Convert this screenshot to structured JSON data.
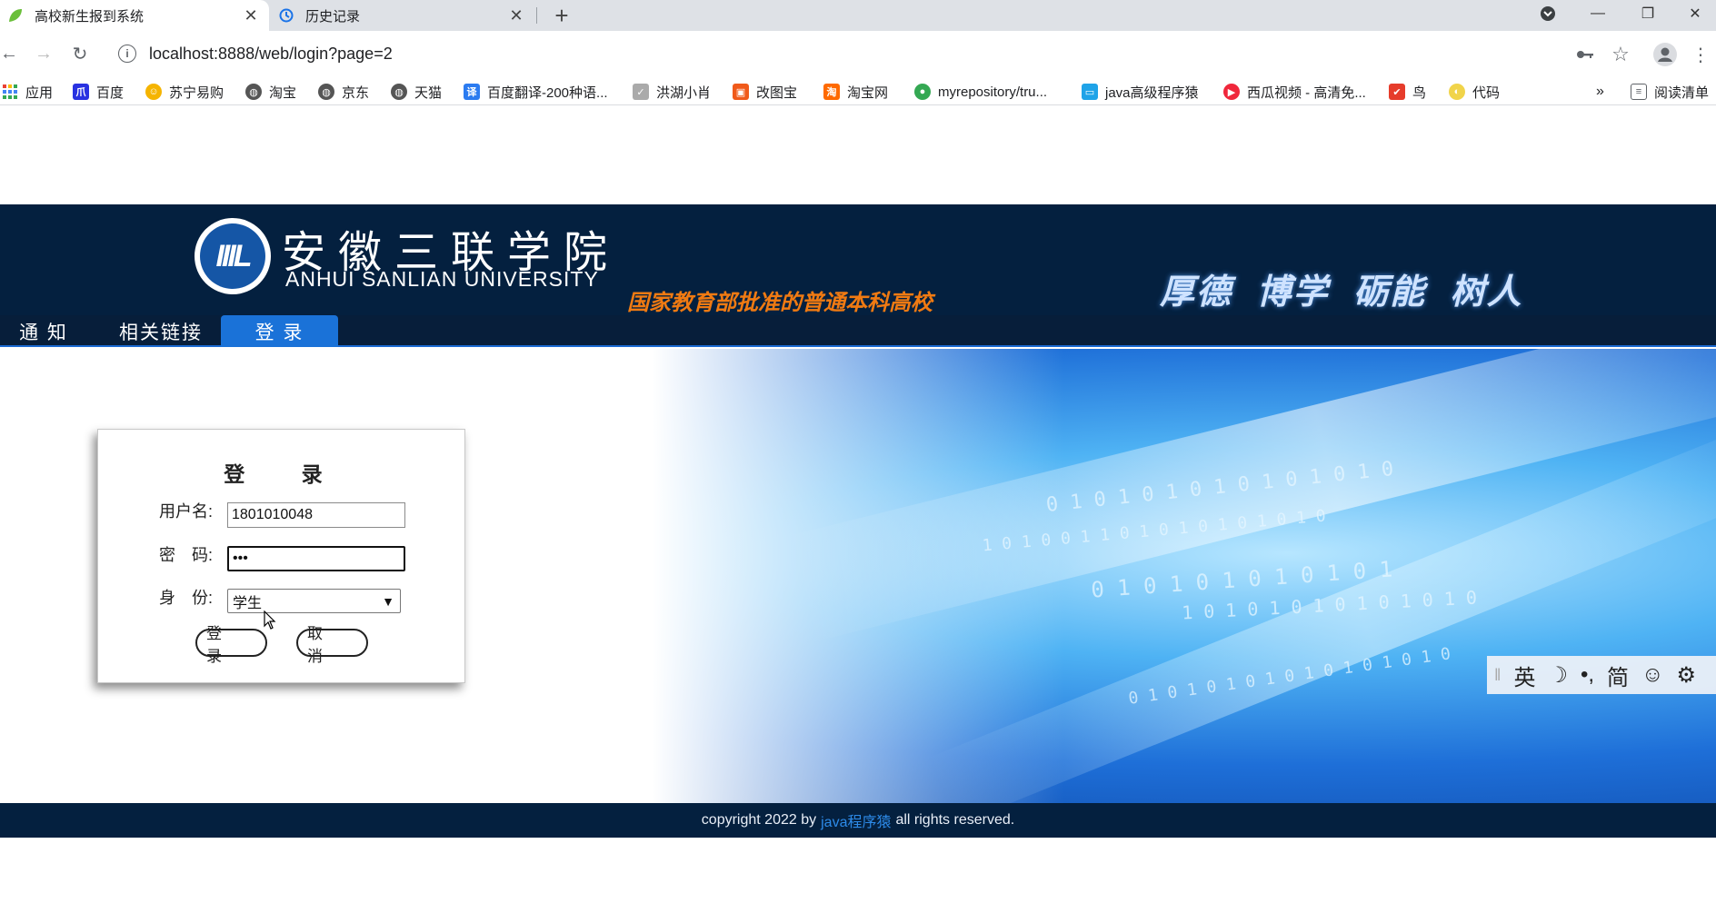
{
  "browser": {
    "tabs": [
      {
        "title": "高校新生报到系统",
        "active": true
      },
      {
        "title": "历史记录",
        "active": false
      }
    ],
    "url": "localhost:8888/web/login?page=2",
    "bookmarks": [
      {
        "label": "应用",
        "icon": "apps-grid-icon",
        "color": "#1a73e8"
      },
      {
        "label": "百度",
        "icon": "baidu-icon",
        "color": "#2932e1"
      },
      {
        "label": "苏宁易购",
        "icon": "suning-icon",
        "color": "#f5b400"
      },
      {
        "label": "淘宝",
        "icon": "globe-icon",
        "color": "#555555"
      },
      {
        "label": "京东",
        "icon": "globe-icon",
        "color": "#555555"
      },
      {
        "label": "天猫",
        "icon": "globe-icon",
        "color": "#555555"
      },
      {
        "label": "百度翻译-200种语...",
        "icon": "translate-icon",
        "color": "#2b7bf0"
      },
      {
        "label": "洪湖小肖",
        "icon": "bird-icon",
        "color": "#777777"
      },
      {
        "label": "改图宝",
        "icon": "image-tool-icon",
        "color": "#f05a1a"
      },
      {
        "label": "淘宝网",
        "icon": "taobao-icon",
        "color": "#ff6a00"
      },
      {
        "label": "myrepository/tru...",
        "icon": "chrome-icon",
        "color": "#34a853"
      },
      {
        "label": "java高级程序猿",
        "icon": "bilibili-icon",
        "color": "#1fa3e8"
      },
      {
        "label": "西瓜视频 - 高清免...",
        "icon": "xigua-icon",
        "color": "#f0273b"
      },
      {
        "label": "鸟",
        "icon": "bird-red-icon",
        "color": "#e63c2b"
      },
      {
        "label": "代码",
        "icon": "code-icon",
        "color": "#f1d44a"
      }
    ],
    "more_bookmarks": "»",
    "reading_list": "阅读清单"
  },
  "header": {
    "school_name_cn": "安徽三联学院",
    "school_name_en": "ANHUI SANLIAN UNIVERSITY",
    "logo_text": "IIIL",
    "slogan": "国家教育部批准的普通本科高校",
    "motto": "厚德 博学 砺能 树人"
  },
  "nav": {
    "items": [
      {
        "label": "通 知",
        "active": false
      },
      {
        "label": "相关链接",
        "active": false
      },
      {
        "label": "登 录",
        "active": true
      }
    ]
  },
  "login": {
    "title": "登 录",
    "username_label": "用户名:",
    "username_value": "1801010048",
    "password_label": "密　码:",
    "password_value": "•••",
    "role_label": "身　份:",
    "role_value": "学生",
    "submit_label": "登 录",
    "cancel_label": "取 消"
  },
  "ime": {
    "items": [
      "英",
      "☽",
      "•,",
      "简",
      "☺",
      "⚙"
    ]
  },
  "footer": {
    "prefix": "copyright 2022 by",
    "author": "java程序猿",
    "suffix": "all rights reserved."
  },
  "colors": {
    "banner": "#04203f",
    "nav_active": "#1a72d8",
    "slogan": "#f07a12",
    "footer_link": "#2d8ae8"
  }
}
